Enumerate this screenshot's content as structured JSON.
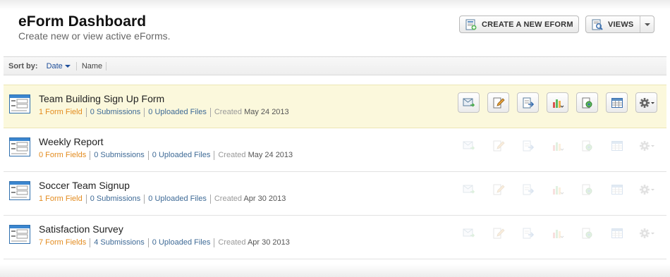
{
  "header": {
    "title": "eForm Dashboard",
    "subtitle": "Create new or view active eForms.",
    "create_button": "CREATE A NEW EFORM",
    "views_button": "VIEWS"
  },
  "sortbar": {
    "label": "Sort by:",
    "date": "Date",
    "name": "Name"
  },
  "forms": [
    {
      "name": "Team Building Sign Up Form",
      "fields": "1 Form Field",
      "submissions": "0 Submissions",
      "files": "0 Uploaded Files",
      "created_label": "Created",
      "created_date": "May 24 2013",
      "selected": true
    },
    {
      "name": "Weekly Report",
      "fields": "0 Form Fields",
      "submissions": "0 Submissions",
      "files": "0 Uploaded Files",
      "created_label": "Created",
      "created_date": "May 24 2013",
      "selected": false
    },
    {
      "name": "Soccer Team Signup",
      "fields": "1 Form Field",
      "submissions": "0 Submissions",
      "files": "0 Uploaded Files",
      "created_label": "Created",
      "created_date": "Apr 30 2013",
      "selected": false
    },
    {
      "name": "Satisfaction Survey",
      "fields": "7 Form Fields",
      "submissions": "4 Submissions",
      "files": "0 Uploaded Files",
      "created_label": "Created",
      "created_date": "Apr 30 2013",
      "selected": false
    }
  ],
  "row_actions": [
    "email-icon",
    "edit-icon",
    "export-icon",
    "report-chart-icon",
    "share-icon",
    "table-icon",
    "settings-gear-icon"
  ],
  "colors": {
    "selected_row_bg": "#fbf8dc",
    "field_count": "#e38b1e",
    "link_blue": "#3e6a96",
    "sort_active": "#1f4f9a"
  }
}
